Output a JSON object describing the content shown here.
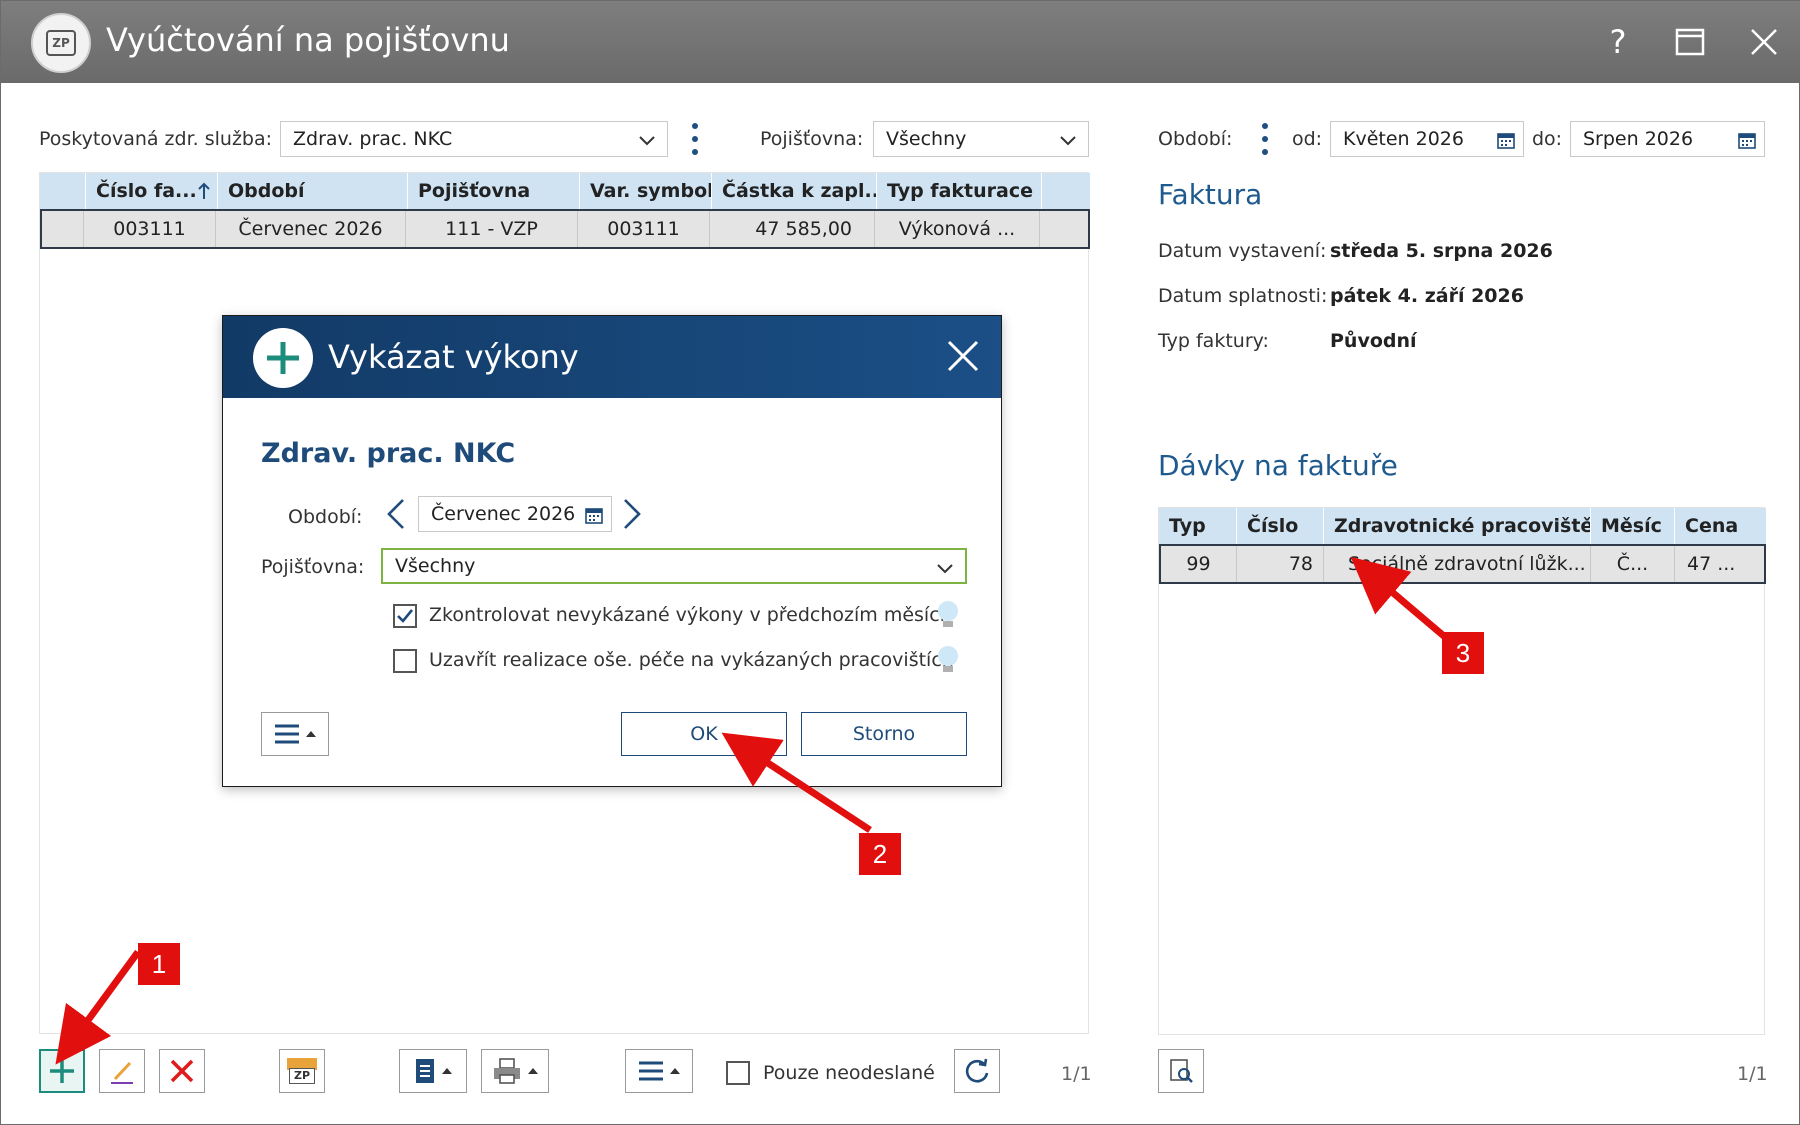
{
  "window": {
    "title": "Vyúčtování na pojišťovnu",
    "app_logo_text": "ZP",
    "help_label": "?",
    "maximize_icon": "window-maximize-icon",
    "close_icon": "close-icon"
  },
  "filters": {
    "service_label": "Poskytovaná zdr. služba:",
    "service_value": "Zdrav. prac. NKC",
    "insurer_label": "Pojišťovna:",
    "insurer_value": "Všechny",
    "period_label": "Období:",
    "from_label": "od:",
    "from_value": "Květen 2026",
    "to_label": "do:",
    "to_value": "Srpen 2026"
  },
  "invoices_table": {
    "columns": [
      "Číslo fa...",
      "Období",
      "Pojišťovna",
      "Var. symbol",
      "Částka k zapl...",
      "Typ fakturace"
    ],
    "rows": [
      {
        "number": "003111",
        "period": "Červenec 2026",
        "insurer": "111 - VZP",
        "var_symbol": "003111",
        "amount": "47 585,00",
        "type": "Výkonová ..."
      }
    ]
  },
  "invoice_detail": {
    "heading": "Faktura",
    "issue_label": "Datum vystavení:",
    "issue_value": "středa 5. srpna 2026",
    "due_label": "Datum splatnosti:",
    "due_value": "pátek 4. září 2026",
    "type_label": "Typ faktury:",
    "type_value": "Původní"
  },
  "batches": {
    "heading": "Dávky na faktuře",
    "columns": [
      "Typ",
      "Číslo",
      "Zdravotnické pracoviště",
      "Měsíc",
      "Cena"
    ],
    "rows": [
      {
        "type": "99",
        "number": "78",
        "workplace": "Sociálně zdravotní lůžk...",
        "month": "Č...",
        "price": "47 ..."
      }
    ],
    "pager": "1/1"
  },
  "toolbar": {
    "only_unsent_label": "Pouze neodeslané",
    "pager": "1/1",
    "zp_label": "ZP"
  },
  "dialog": {
    "title": "Vykázat výkony",
    "subtitle": "Zdrav. prac. NKC",
    "period_label": "Období:",
    "period_value": "Červenec 2026",
    "insurer_label": "Pojišťovna:",
    "insurer_value": "Všechny",
    "check1_label": "Zkontrolovat nevykázané výkony v předchozím měsíci",
    "check1_checked": true,
    "check2_label": "Uzavřít realizace oše. péče na vykázaných pracovištích",
    "check2_checked": false,
    "ok_label": "OK",
    "cancel_label": "Storno"
  },
  "annotations": {
    "badge1": "1",
    "badge2": "2",
    "badge3": "3",
    "color": "#e20f0f"
  },
  "colors": {
    "titlebar": "#707070",
    "table_header": "#cfe3f3",
    "accent_blue": "#1f5a8f",
    "dialog_header": "#123a66",
    "add_green": "#1c8c7c"
  }
}
